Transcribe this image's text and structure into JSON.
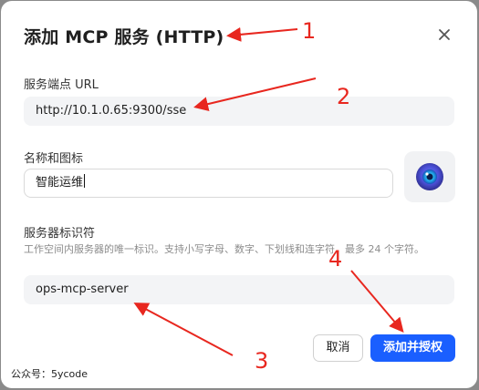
{
  "dialog": {
    "title": "添加 MCP 服务 (HTTP)",
    "close_icon": "close-icon"
  },
  "endpoint": {
    "label": "服务端点 URL",
    "value": "http://10.1.0.65:9300/sse"
  },
  "name_icon": {
    "label": "名称和图标",
    "value": "智能运维",
    "icon": "eye-logo-icon"
  },
  "identifier": {
    "label": "服务器标识符",
    "hint": "工作空间内服务器的唯一标识。支持小写字母、数字、下划线和连字符，最多 24 个字符。",
    "value": "ops-mcp-server"
  },
  "buttons": {
    "cancel": "取消",
    "submit": "添加并授权"
  },
  "watermark": "公众号：5ycode",
  "annotations": {
    "color": "#e8271f",
    "labels": [
      "1",
      "2",
      "3",
      "4"
    ]
  },
  "colors": {
    "primary": "#1a5fff",
    "field_bg": "#f3f4f6"
  }
}
